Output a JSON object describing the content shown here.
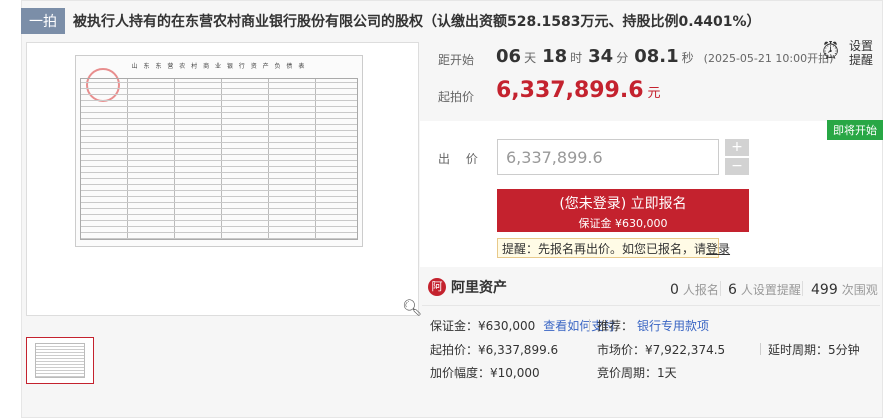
{
  "header": {
    "tag": "一拍",
    "title": "被执行人持有的在东营农村商业银行股份有限公司的股权（认缴出资额528.1583万元、持股比例0.4401%）"
  },
  "gallery": {
    "doc_title": "山 东 东 营 农 村 商 业 银 行 资 产 负 债 表",
    "zoom_icon": "magnifier-icon"
  },
  "countdown": {
    "label": "距开始",
    "days": "06",
    "days_unit": "天",
    "hours": "18",
    "hours_unit": "时",
    "minutes": "34",
    "minutes_unit": "分",
    "seconds": "08.1",
    "seconds_unit": "秒",
    "start_time": "(2025-05-21 10:00开拍)"
  },
  "remind": {
    "icon": "alarm-clock-icon",
    "label": "设置\n提醒"
  },
  "start_price": {
    "label": "起拍价",
    "value": "6,337,899.6",
    "unit": "元"
  },
  "status_badge": "即将开始",
  "bid": {
    "label": "出  价",
    "value": "6,337,899.6",
    "plus": "+",
    "minus": "−",
    "cta_main": "(您未登录) 立即报名",
    "cta_sub": "保证金 ¥630,000",
    "tip_prefix": "提醒：先报名再出价。如您已报名，请",
    "tip_link": "登录"
  },
  "platform": {
    "logo": "阿",
    "name": "阿里资产"
  },
  "stats": [
    {
      "count": "0",
      "text": "人报名"
    },
    {
      "count": "6",
      "text": "人设置提醒"
    },
    {
      "count": "499",
      "text": "次围观"
    }
  ],
  "details": {
    "deposit_label": "保证金：¥630,000",
    "pay_link": "查看如何支付",
    "recommend_label": "推荐：",
    "recommend_link": "银行专用款项",
    "start_price": "起拍价：¥6,337,899.6",
    "market_price": "市场价：¥7,922,374.5",
    "delay": "延时周期：5分钟",
    "increment": "加价幅度：¥10,000",
    "bid_period": "竞价周期：1天"
  }
}
